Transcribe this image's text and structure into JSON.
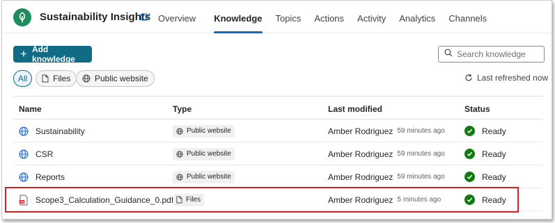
{
  "header": {
    "app_title": "Sustainability Insights",
    "tabs": [
      {
        "label": "Overview",
        "active": false
      },
      {
        "label": "Knowledge",
        "active": true
      },
      {
        "label": "Topics",
        "active": false
      },
      {
        "label": "Actions",
        "active": false
      },
      {
        "label": "Activity",
        "active": false
      },
      {
        "label": "Analytics",
        "active": false
      },
      {
        "label": "Channels",
        "active": false
      }
    ]
  },
  "toolbar": {
    "add_label": "Add knowledge",
    "search_placeholder": "Search knowledge"
  },
  "filters": {
    "all": "All",
    "files": "Files",
    "public_website": "Public website"
  },
  "refresh_label": "Last refreshed now",
  "table": {
    "columns": [
      "Name",
      "Type",
      "Last modified",
      "Status"
    ],
    "rows": [
      {
        "name": "Sustainability",
        "icon": "globe-icon",
        "type": "Public website",
        "user": "Amber Rodriguez",
        "time": "59 minutes ago",
        "status": "Ready"
      },
      {
        "name": "CSR",
        "icon": "globe-icon",
        "type": "Public website",
        "user": "Amber Rodriguez",
        "time": "59 minutes ago",
        "status": "Ready"
      },
      {
        "name": "Reports",
        "icon": "globe-icon",
        "type": "Public website",
        "user": "Amber Rodriguez",
        "time": "59 minutes ago",
        "status": "Ready"
      },
      {
        "name": "Scope3_Calculation_Guidance_0.pdf",
        "icon": "pdf-icon",
        "type": "Files",
        "user": "Amber Rodriguez",
        "time": "5 minutes ago",
        "status": "Ready"
      }
    ]
  },
  "colors": {
    "accent": "#0f6c84",
    "status_ready": "#107c10",
    "highlight": "#d62020",
    "tab_indicator": "#0f6cbd"
  }
}
